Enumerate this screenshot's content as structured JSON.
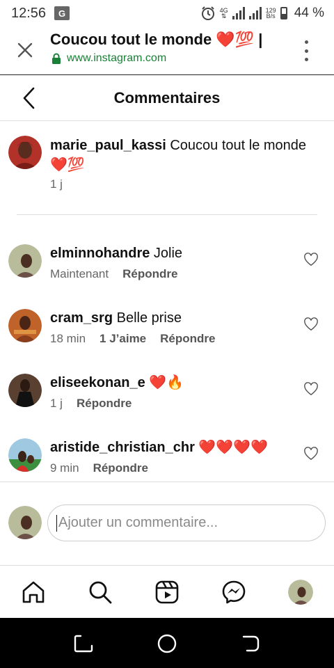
{
  "status_bar": {
    "time": "12:56",
    "translate_glyph": "G",
    "network": "4G",
    "speed_value": "129",
    "speed_unit": "B/s",
    "battery": "44 %",
    "icons": [
      "translate-icon",
      "alarm-icon",
      "signal-icon",
      "battery-icon"
    ]
  },
  "browser": {
    "title": "Coucou tout le monde ❤️💯 |",
    "url": "www.instagram.com",
    "accent": "#1a7f37"
  },
  "header": {
    "title": "Commentaires"
  },
  "caption": {
    "username": "marie_paul_kassi",
    "text": " Coucou tout le monde ❤️💯",
    "time": "1 j"
  },
  "comments": [
    {
      "username": "elminnohandre",
      "text": " Jolie",
      "time": "Maintenant",
      "likes": "",
      "reply": "Répondre"
    },
    {
      "username": "cram_srg",
      "text": " Belle prise",
      "time": "18 min",
      "likes": "1 J’aime",
      "reply": "Répondre"
    },
    {
      "username": "eliseekonan_e",
      "text": " ❤️🔥",
      "time": "1 j",
      "likes": "",
      "reply": "Répondre"
    },
    {
      "username": "aristide_christian_chr",
      "text": " ❤️❤️❤️❤️",
      "time": "9 min",
      "likes": "",
      "reply": "Répondre"
    }
  ],
  "comment_input": {
    "placeholder": "Ajouter un commentaire..."
  },
  "bottom_nav": [
    "home-icon",
    "search-icon",
    "reels-icon",
    "messenger-icon",
    "profile-avatar"
  ],
  "colors": {
    "heart_red": "#e0212f",
    "text": "#111111",
    "muted": "#666666"
  }
}
